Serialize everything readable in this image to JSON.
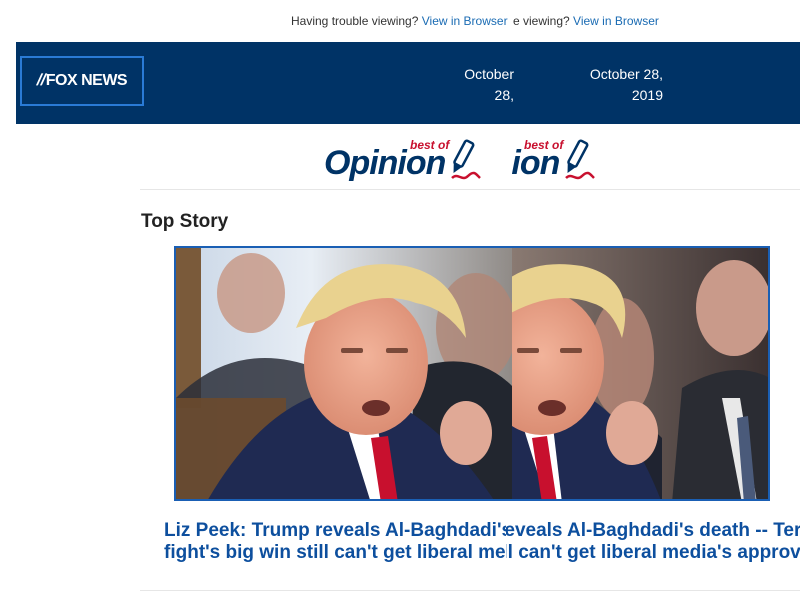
{
  "preheader": {
    "text": "Having trouble viewing?",
    "link": "View in Browser",
    "overlap_text": "e viewing?"
  },
  "header": {
    "logo": "FOX NEWS",
    "date_line1": "October 28,",
    "date_line2": "2019"
  },
  "opinion_logo": {
    "best_of": "best of",
    "word": "Opinion"
  },
  "section": {
    "label": "Top Story"
  },
  "story": {
    "headline_line1": "Liz Peek: Trump reveals Al-Baghdadi's death -- Terror",
    "headline_line2": "fight's big win still can't get liberal media's approval"
  },
  "colors": {
    "header_bg": "#003366",
    "link": "#1a6bb3",
    "headline": "#0d4f9e",
    "accent_red": "#c8102e"
  }
}
